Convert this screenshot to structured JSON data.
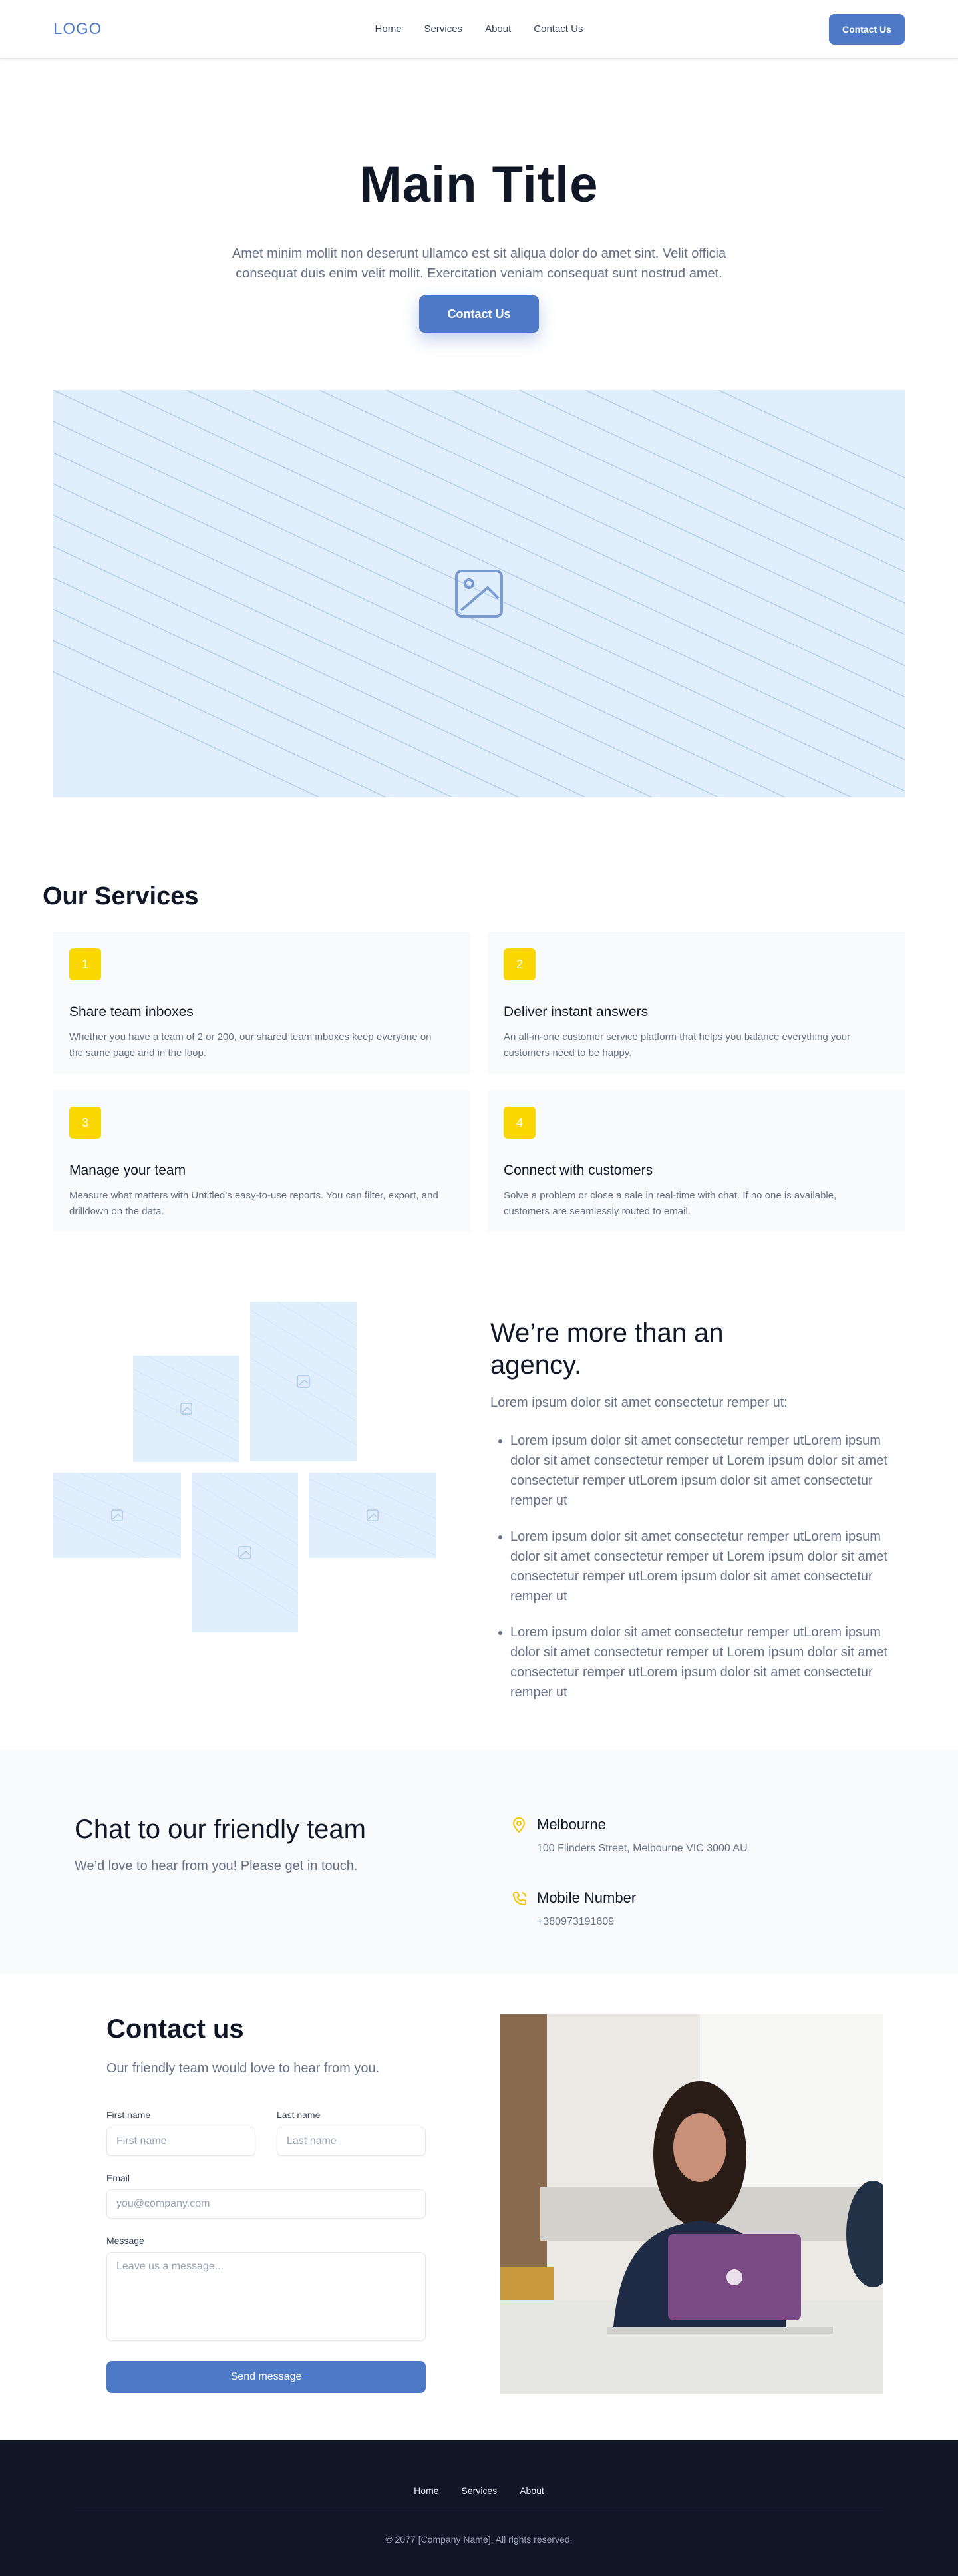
{
  "header": {
    "logo": "LOGO",
    "nav": [
      "Home",
      "Services",
      "About",
      "Contact Us"
    ],
    "cta_label": "Contact Us"
  },
  "hero": {
    "title": "Main Title",
    "description": "Amet minim mollit non deserunt ullamco est sit aliqua dolor do amet sint. Velit officia consequat duis enim velit mollit. Exercitation veniam consequat sunt nostrud amet.",
    "cta_label": "Contact Us"
  },
  "services": {
    "title": "Our Services",
    "items": [
      {
        "number": "1",
        "title": "Share team inboxes",
        "text": "Whether you have a team of 2 or 200, our shared team inboxes keep everyone on the same page and in the loop."
      },
      {
        "number": "2",
        "title": "Deliver instant answers",
        "text": "An all-in-one customer service platform that helps you balance everything your customers need to be happy."
      },
      {
        "number": "3",
        "title": "Manage your team",
        "text": "Measure what matters with Untitled's easy-to-use reports. You can filter, export, and drilldown on the data."
      },
      {
        "number": "4",
        "title": "Connect with customers",
        "text": "Solve a problem or close a sale in real-time with chat. If no one is available, customers are seamlessly routed to email."
      }
    ]
  },
  "agency": {
    "title": "We’re more than an agency.",
    "lead": "Lorem ipsum dolor sit amet consectetur remper ut:",
    "bullets": [
      "Lorem ipsum dolor sit amet consectetur remper utLorem ipsum dolor sit amet consectetur remper ut Lorem ipsum dolor sit amet consectetur remper utLorem ipsum dolor sit amet consectetur remper ut",
      "Lorem ipsum dolor sit amet consectetur remper utLorem ipsum dolor sit amet consectetur remper ut Lorem ipsum dolor sit amet consectetur remper utLorem ipsum dolor sit amet consectetur remper ut",
      "Lorem ipsum dolor sit amet consectetur remper utLorem ipsum dolor sit amet consectetur remper ut Lorem ipsum dolor sit amet consectetur remper utLorem ipsum dolor sit amet consectetur remper ut"
    ]
  },
  "chat": {
    "title": "Chat to our friendly team",
    "subtitle": "We’d love to hear from you! Please get in touch.",
    "location_icon": "map-pin-icon",
    "location_title": "Melbourne",
    "location_value": "100 Flinders Street, Melbourne VIC 3000 AU",
    "phone_icon": "phone-icon",
    "phone_title": "Mobile Number",
    "phone_value": "+380973191609"
  },
  "contact": {
    "title": "Contact us",
    "subtitle": "Our friendly team would love to hear from you.",
    "first_name_label": "First name",
    "first_name_placeholder": "First name",
    "last_name_label": "Last name",
    "last_name_placeholder": "Last name",
    "email_label": "Email",
    "email_placeholder": "you@company.com",
    "message_label": "Message",
    "message_placeholder": "Leave us a message...",
    "submit_label": "Send message"
  },
  "footer": {
    "nav": [
      "Home",
      "Services",
      "About"
    ],
    "copyright": "© 2077 [Company Name]. All rights reserved."
  },
  "colors": {
    "accent": "#4e79c6",
    "badge": "#fad700",
    "footer_bg": "#111727",
    "placeholder_bg": "#e1effd"
  }
}
